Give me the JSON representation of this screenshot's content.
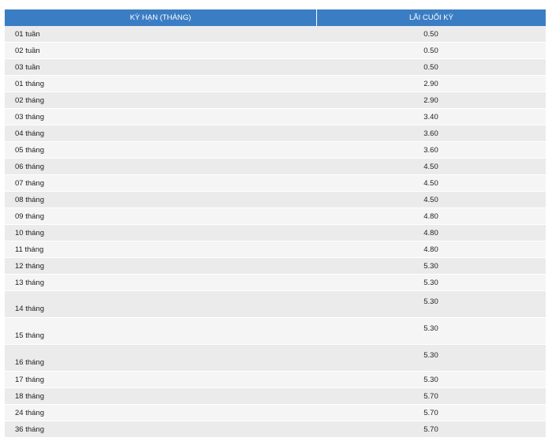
{
  "table": {
    "headers": {
      "term": "KỲ HẠN (THÁNG)",
      "rate": "LÃI CUỐI KỲ"
    },
    "rows": [
      {
        "term": "01 tuần",
        "rate": "0.50"
      },
      {
        "term": "02 tuần",
        "rate": "0.50"
      },
      {
        "term": "03 tuần",
        "rate": "0.50"
      },
      {
        "term": "01 tháng",
        "rate": "2.90"
      },
      {
        "term": "02 tháng",
        "rate": "2.90"
      },
      {
        "term": "03 tháng",
        "rate": "3.40"
      },
      {
        "term": "04 tháng",
        "rate": "3.60"
      },
      {
        "term": "05 tháng",
        "rate": "3.60"
      },
      {
        "term": "06 tháng",
        "rate": "4.50"
      },
      {
        "term": "07 tháng",
        "rate": "4.50"
      },
      {
        "term": "08 tháng",
        "rate": "4.50"
      },
      {
        "term": "09 tháng",
        "rate": "4.80"
      },
      {
        "term": "10 tháng",
        "rate": "4.80"
      },
      {
        "term": "11 tháng",
        "rate": "4.80"
      },
      {
        "term": "12 tháng",
        "rate": "5.30"
      },
      {
        "term": "13 tháng",
        "rate": "5.30"
      },
      {
        "term": "14 tháng",
        "rate": "5.30"
      },
      {
        "term": "15 tháng",
        "rate": "5.30"
      },
      {
        "term": "16 tháng",
        "rate": "5.30"
      },
      {
        "term": "17 tháng",
        "rate": "5.30"
      },
      {
        "term": "18 tháng",
        "rate": "5.70"
      },
      {
        "term": "24 tháng",
        "rate": "5.70"
      },
      {
        "term": "36 tháng",
        "rate": "5.70"
      }
    ]
  },
  "colors": {
    "header_bg": "#3b7dc4",
    "header_text": "#ffffff",
    "row_odd": "#ebebeb",
    "row_even": "#f5f5f5"
  }
}
